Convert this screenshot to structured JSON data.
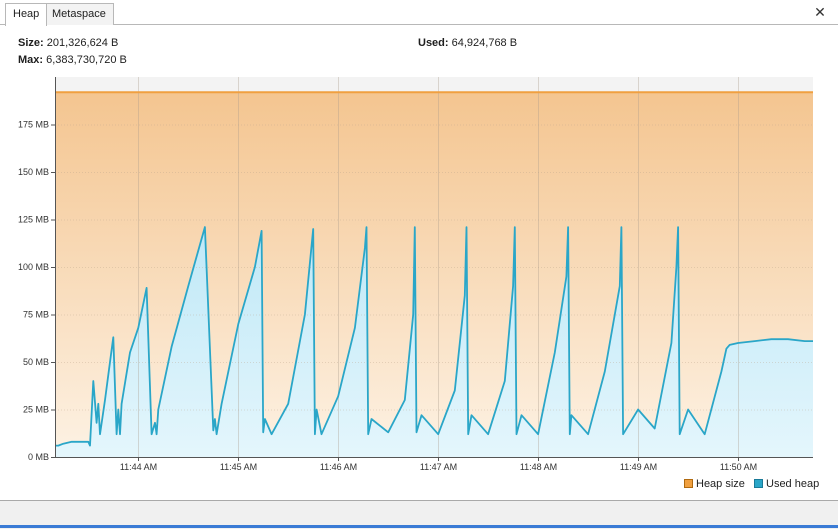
{
  "tabs": [
    {
      "label": "Heap",
      "active": true
    },
    {
      "label": "Metaspace",
      "active": false
    }
  ],
  "close_icon": "close-icon",
  "info": {
    "size_label": "Size:",
    "size_value": "201,326,624 B",
    "max_label": "Max:",
    "max_value": "6,383,730,720 B",
    "used_label": "Used:",
    "used_value": "64,924,768 B"
  },
  "legend": {
    "heap_size_label": "Heap size",
    "used_heap_label": "Used heap"
  },
  "colors": {
    "heap_size": "#f0a040",
    "heap_fill_top": "#f4c590",
    "heap_fill_bottom": "#fdf2e4",
    "used_heap": "#2aa6c8",
    "used_fill": "#c8ecf8"
  },
  "chart_data": {
    "type": "area",
    "y_unit": "MB",
    "ylim": [
      0,
      200
    ],
    "y_ticks": [
      0,
      25,
      50,
      75,
      100,
      125,
      150,
      175
    ],
    "y_tick_labels": [
      "0 MB",
      "25 MB",
      "50 MB",
      "75 MB",
      "100 MB",
      "125 MB",
      "150 MB",
      "175 MB"
    ],
    "x_range": [
      "11:43:10",
      "11:50:45"
    ],
    "x_ticks": [
      "11:44:00",
      "11:45:00",
      "11:46:00",
      "11:47:00",
      "11:48:00",
      "11:49:00",
      "11:50:00"
    ],
    "x_tick_labels": [
      "11:44 AM",
      "11:45 AM",
      "11:46 AM",
      "11:47 AM",
      "11:48 AM",
      "11:49 AM",
      "11:50 AM"
    ],
    "grid": true,
    "legend_position": "bottom-right",
    "series": [
      {
        "name": "Heap size",
        "x": [
          "11:43:10",
          "11:50:45"
        ],
        "y": [
          192,
          192
        ]
      },
      {
        "name": "Used heap",
        "x": [
          "11:43:10",
          "11:43:12",
          "11:43:15",
          "11:43:20",
          "11:43:30",
          "11:43:31",
          "11:43:33",
          "11:43:35",
          "11:43:36",
          "11:43:37",
          "11:43:40",
          "11:43:43",
          "11:43:45",
          "11:43:47",
          "11:43:48",
          "11:43:49",
          "11:43:50",
          "11:43:55",
          "11:44:00",
          "11:44:05",
          "11:44:08",
          "11:44:10",
          "11:44:11",
          "11:44:12",
          "11:44:20",
          "11:44:30",
          "11:44:40",
          "11:44:45",
          "11:44:46",
          "11:44:47",
          "11:44:50",
          "11:45:00",
          "11:45:10",
          "11:45:14",
          "11:45:15",
          "11:45:16",
          "11:45:20",
          "11:45:30",
          "11:45:40",
          "11:45:45",
          "11:45:46",
          "11:45:47",
          "11:45:50",
          "11:46:00",
          "11:46:10",
          "11:46:16",
          "11:46:17",
          "11:46:18",
          "11:46:20",
          "11:46:30",
          "11:46:40",
          "11:46:45",
          "11:46:46",
          "11:46:47",
          "11:46:50",
          "11:47:00",
          "11:47:10",
          "11:47:16",
          "11:47:17",
          "11:47:18",
          "11:47:20",
          "11:47:30",
          "11:47:40",
          "11:47:45",
          "11:47:46",
          "11:47:47",
          "11:47:50",
          "11:48:00",
          "11:48:10",
          "11:48:17",
          "11:48:18",
          "11:48:19",
          "11:48:20",
          "11:48:30",
          "11:48:40",
          "11:48:49",
          "11:48:50",
          "11:48:51",
          "11:49:00",
          "11:49:10",
          "11:49:20",
          "11:49:23",
          "11:49:24",
          "11:49:25",
          "11:49:30",
          "11:49:40",
          "11:49:50",
          "11:49:53",
          "11:49:54",
          "11:49:55",
          "11:50:00",
          "11:50:10",
          "11:50:20",
          "11:50:30",
          "11:50:40",
          "11:50:45"
        ],
        "y": [
          6,
          6,
          7,
          8,
          8,
          6,
          40,
          18,
          28,
          12,
          30,
          50,
          63,
          12,
          25,
          12,
          28,
          55,
          68,
          89,
          12,
          18,
          12,
          25,
          58,
          90,
          121,
          14,
          20,
          12,
          28,
          70,
          100,
          119,
          13,
          20,
          12,
          28,
          75,
          120,
          12,
          25,
          12,
          32,
          68,
          110,
          121,
          12,
          20,
          13,
          30,
          75,
          121,
          13,
          22,
          12,
          35,
          85,
          121,
          12,
          22,
          12,
          40,
          90,
          121,
          12,
          22,
          12,
          55,
          95,
          121,
          12,
          22,
          12,
          45,
          90,
          121,
          12,
          25,
          15,
          60,
          100,
          121,
          12,
          25,
          12,
          45,
          57,
          58,
          59,
          60,
          61,
          62,
          62,
          61,
          61
        ]
      }
    ]
  }
}
